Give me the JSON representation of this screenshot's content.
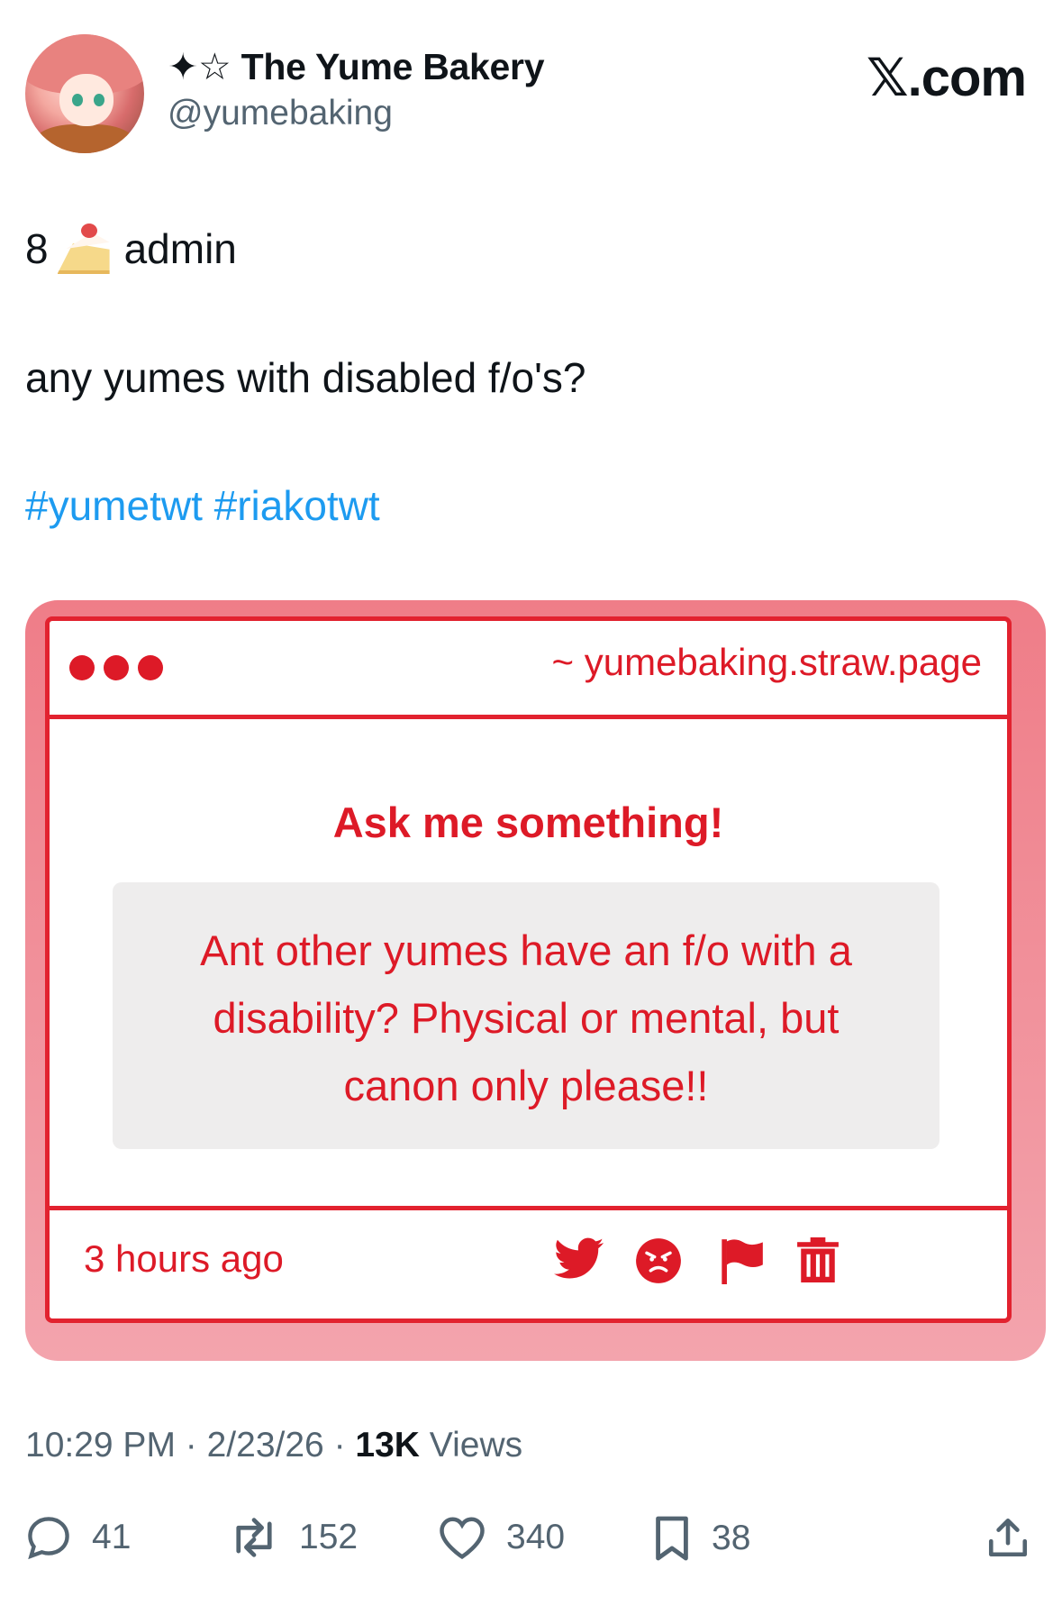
{
  "header": {
    "display_name": "✦☆ The Yume Bakery",
    "handle": "@yumebaking",
    "site": "𝕏.com"
  },
  "tweet": {
    "prefix": "8",
    "admin": "admin",
    "text": "any yumes with disabled f/o's?",
    "hashtags": "#yumetwt #riakotwt"
  },
  "card": {
    "url": "~ yumebaking.straw.page",
    "heading": "Ask me something!",
    "question_lines": [
      "Ant other yumes have an f/o with a",
      "disability? Physical or mental, but",
      "canon only please!!"
    ],
    "time_ago": "3 hours ago",
    "icons": [
      "twitter-bird-icon",
      "angry-face-icon",
      "flag-icon",
      "trash-icon"
    ],
    "accent": "#dd1a27"
  },
  "meta": {
    "time": "10:29 PM",
    "date": "2/23/26",
    "views_count": "13K",
    "views_label": "Views"
  },
  "actions": {
    "replies": "41",
    "reposts": "152",
    "likes": "340",
    "bookmarks": "38"
  }
}
